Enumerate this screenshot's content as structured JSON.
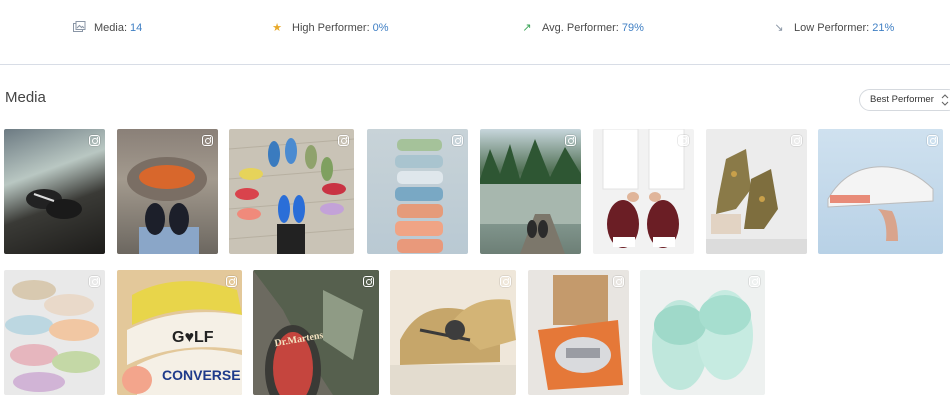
{
  "stats": {
    "media": {
      "label": "Media:",
      "value": "14",
      "icon": "media-icon"
    },
    "high": {
      "label": "High Performer:",
      "value": "0%",
      "icon": "star-icon",
      "color": "#e8a92a"
    },
    "avg": {
      "label": "Avg. Performer:",
      "value": "79%",
      "icon": "arrow-up-right-icon",
      "color": "#3aa457"
    },
    "low": {
      "label": "Low Performer:",
      "value": "21%",
      "icon": "arrow-down-right-icon",
      "color": "#8a96a6"
    }
  },
  "section": {
    "title": "Media"
  },
  "sort": {
    "selected": "Best Performer"
  },
  "accent": "#3f7fc4",
  "media_items": [
    {
      "subject": "sneakers-car-window",
      "source": "instagram-icon"
    },
    {
      "subject": "sneakers-campfire",
      "source": "instagram-icon"
    },
    {
      "subject": "sneakers-circle-deck",
      "source": "instagram-icon"
    },
    {
      "subject": "sneakers-stacked-pastel",
      "source": "instagram-icon"
    },
    {
      "subject": "sneakers-lake-log",
      "source": "instagram-icon"
    },
    {
      "subject": "sneakers-burgundy-lacing",
      "source": "instagram-icon"
    },
    {
      "subject": "boots-floral-legs",
      "source": "instagram-icon"
    },
    {
      "subject": "sneaker-white-hand-sky",
      "source": "instagram-icon"
    },
    {
      "subject": "sneakers-painted-pile",
      "source": "instagram-icon"
    },
    {
      "subject": "converse-golf-yellow",
      "source": "instagram-icon"
    },
    {
      "subject": "dr-martens-camo",
      "source": "instagram-icon"
    },
    {
      "subject": "gold-nike-sneakers",
      "source": "instagram-icon"
    },
    {
      "subject": "sneakers-gift-box",
      "source": "instagram-icon"
    },
    {
      "subject": "mint-fur-slides",
      "source": "instagram-icon"
    }
  ]
}
